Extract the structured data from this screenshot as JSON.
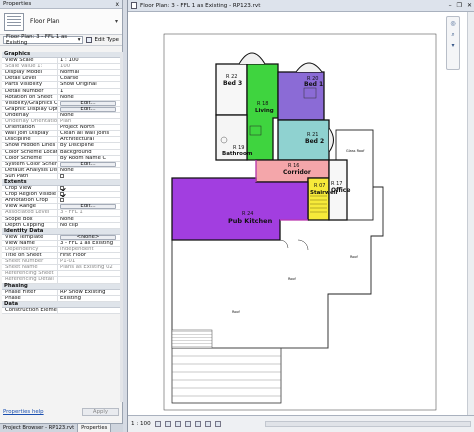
{
  "properties": {
    "title": "Properties",
    "close_label": "x",
    "type_label": "Floor Plan",
    "instance_selector": "Floor Plan: 3 - FFL 1 as Existing",
    "edit_type_label": "Edit Type",
    "help_link": "Properties help",
    "apply_label": "Apply",
    "sections": [
      {
        "name": "Graphics",
        "rows": [
          {
            "k": "View Scale",
            "v": "1 : 100"
          },
          {
            "k": "Scale Value    1:",
            "v": "100",
            "ro": true
          },
          {
            "k": "Display Model",
            "v": "Normal"
          },
          {
            "k": "Detail Level",
            "v": "Coarse"
          },
          {
            "k": "Parts Visibility",
            "v": "Show Original"
          },
          {
            "k": "Detail Number",
            "v": "1"
          },
          {
            "k": "Rotation on Sheet",
            "v": "None"
          },
          {
            "k": "Visibility/Graphics Ove...",
            "v": "Edit...",
            "btn": true
          },
          {
            "k": "Graphic Display Options",
            "v": "Edit...",
            "btn": true
          },
          {
            "k": "Underlay",
            "v": "None"
          },
          {
            "k": "Underlay Orientation",
            "v": "Plan",
            "ro": true
          },
          {
            "k": "Orientation",
            "v": "Project North"
          },
          {
            "k": "Wall Join Display",
            "v": "Clean all wall joins"
          },
          {
            "k": "Discipline",
            "v": "Architectural"
          },
          {
            "k": "Show Hidden Lines",
            "v": "By Discipline"
          },
          {
            "k": "Color Scheme Location",
            "v": "Background"
          },
          {
            "k": "Color Scheme",
            "v": "By Room Name C"
          },
          {
            "k": "System Color Schemes",
            "v": "Edit...",
            "btn": true
          },
          {
            "k": "Default Analysis Displ...",
            "v": "None"
          },
          {
            "k": "Sun Path",
            "v": "",
            "chk": false
          }
        ]
      },
      {
        "name": "Extents",
        "rows": [
          {
            "k": "Crop View",
            "v": "",
            "chk": true
          },
          {
            "k": "Crop Region Visible",
            "v": "",
            "chk": true
          },
          {
            "k": "Annotation Crop",
            "v": "",
            "chk": false
          },
          {
            "k": "View Range",
            "v": "Edit...",
            "btn": true
          },
          {
            "k": "Associated Level",
            "v": "3 - FFL 1",
            "ro": true
          },
          {
            "k": "Scope Box",
            "v": "None"
          },
          {
            "k": "Depth Clipping",
            "v": "No clip"
          }
        ]
      },
      {
        "name": "Identity Data",
        "rows": [
          {
            "k": "View Template",
            "v": "<None>",
            "btn": true
          },
          {
            "k": "View Name",
            "v": "3 - FFL 1 as Existing"
          },
          {
            "k": "Dependency",
            "v": "Independent",
            "ro": true
          },
          {
            "k": "Title on Sheet",
            "v": "First Floor"
          },
          {
            "k": "Sheet Number",
            "v": "P1-01",
            "ro": true
          },
          {
            "k": "Sheet Name",
            "v": "Plans as Existing 02",
            "ro": true
          },
          {
            "k": "Referencing Sheet",
            "v": "",
            "ro": true
          },
          {
            "k": "Referencing Detail",
            "v": "",
            "ro": true
          }
        ]
      },
      {
        "name": "Phasing",
        "rows": [
          {
            "k": "Phase Filter",
            "v": "RP Show Existing"
          },
          {
            "k": "Phase",
            "v": "Existing"
          }
        ]
      },
      {
        "name": "Data",
        "rows": [
          {
            "k": "Construction Element",
            "v": ""
          }
        ]
      }
    ]
  },
  "bottom_tabs": [
    "Project Browser - RP123.rvt",
    "Properties"
  ],
  "view": {
    "tab_title": "Floor Plan: 3 - FFL 1 as Existing - RP123.rvt",
    "scale": "1 : 100",
    "rooms": [
      {
        "num": "R 22",
        "name": "Bed 3",
        "color": "#f7f7f7"
      },
      {
        "num": "R 18",
        "name": "Living",
        "color": "#3fd43f"
      },
      {
        "num": "R 20",
        "name": "Bed 1",
        "color": "#8b6bd6"
      },
      {
        "num": "R 21",
        "name": "Bed 2",
        "color": "#8fd2d0"
      },
      {
        "num": "R 19",
        "name": "Bathroom",
        "color": "#f5f5f5"
      },
      {
        "num": "R 16",
        "name": "Corridor",
        "color": "#f4a6aa"
      },
      {
        "num": "R 07",
        "name": "Stairwell",
        "color": "#f6ea3a"
      },
      {
        "num": "R 17",
        "name": "Office",
        "color": "#f7f7f7"
      },
      {
        "num": "R 24",
        "name": "Pub Kitchen",
        "color": "#a23ee0"
      }
    ],
    "annotations": [
      "Glass Roof",
      "Roof",
      "Roof",
      "Roof"
    ],
    "colors": {
      "wall": "#111111",
      "magenta": "#e63fd6"
    }
  }
}
